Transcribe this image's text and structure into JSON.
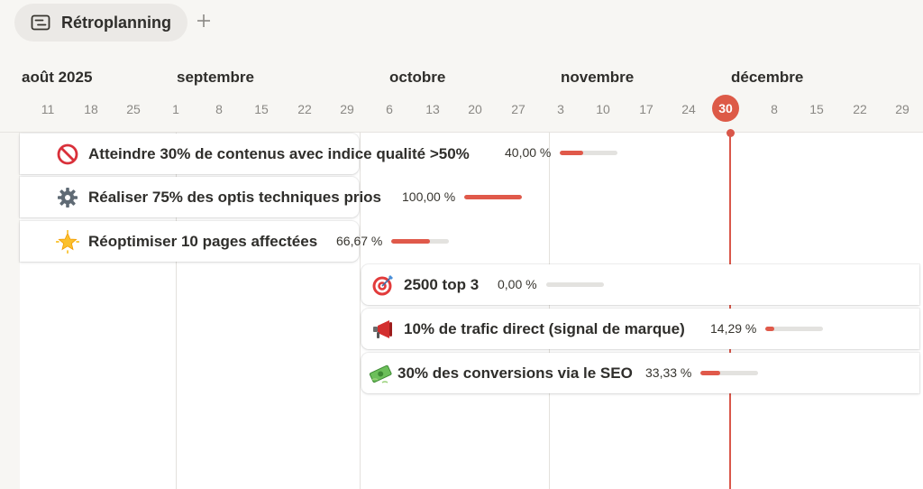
{
  "header": {
    "view_tab_label": "Rétroplanning",
    "add_view_symbol": "+"
  },
  "timeline": {
    "months": [
      "août 2025",
      "septembre",
      "octobre",
      "novembre",
      "décembre"
    ],
    "days": [
      "11",
      "18",
      "25",
      "1",
      "8",
      "15",
      "22",
      "29",
      "6",
      "13",
      "20",
      "27",
      "3",
      "10",
      "17",
      "24",
      "30",
      "8",
      "15",
      "22",
      "29"
    ],
    "today_label": "30",
    "accent_color": "#dd5a47"
  },
  "tasks": [
    {
      "title": "Atteindre 30% de contenus avec indice qualité >50%",
      "percent_label": "40,00 %",
      "progress": 0.4,
      "icon": "prohibited-icon"
    },
    {
      "title": "Réaliser 75% des optis techniques prios",
      "percent_label": "100,00 %",
      "progress": 1.0,
      "icon": "gear-icon"
    },
    {
      "title": "Réoptimiser 10 pages affectées",
      "percent_label": "66,67 %",
      "progress": 0.6667,
      "icon": "star-icon"
    },
    {
      "title": "2500 top 3",
      "percent_label": "0,00 %",
      "progress": 0.0,
      "icon": "target-icon"
    },
    {
      "title": "10% de trafic direct (signal de marque)",
      "percent_label": "14,29 %",
      "progress": 0.1429,
      "icon": "megaphone-icon"
    },
    {
      "title": "30% des conversions via le SEO",
      "percent_label": "33,33 %",
      "progress": 0.3333,
      "icon": "money-icon"
    }
  ]
}
